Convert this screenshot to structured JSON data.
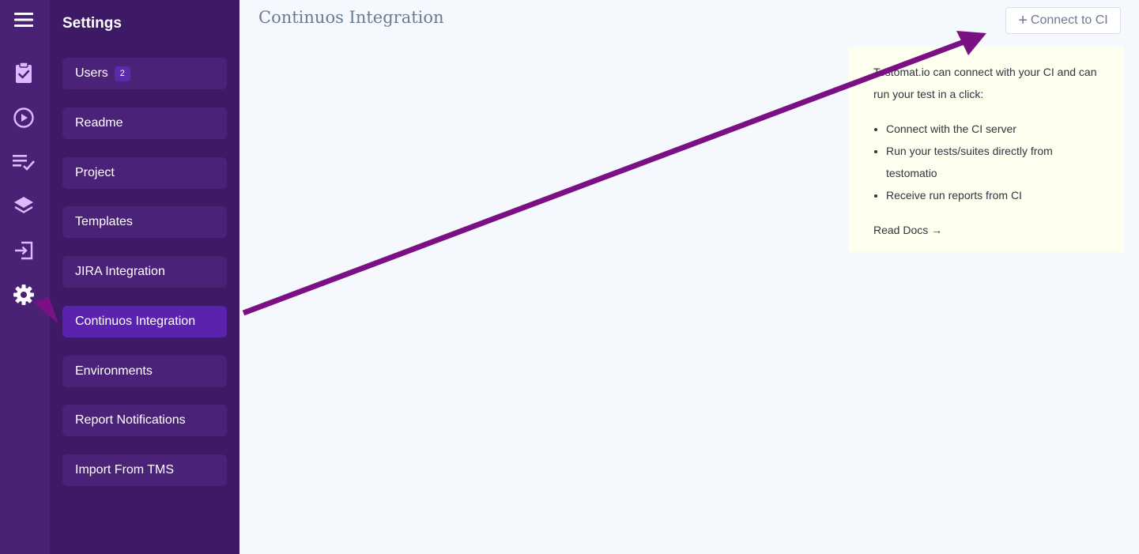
{
  "rail": {
    "icons": [
      "hamburger-menu-icon",
      "clipboard-check-icon",
      "play-circle-icon",
      "checklist-icon",
      "layers-icon",
      "import-icon",
      "gear-icon"
    ]
  },
  "sidebar": {
    "title": "Settings",
    "items": [
      {
        "label": "Users",
        "badge": "2"
      },
      {
        "label": "Readme"
      },
      {
        "label": "Project"
      },
      {
        "label": "Templates"
      },
      {
        "label": "JIRA Integration"
      },
      {
        "label": "Continuos Integration",
        "active": true
      },
      {
        "label": "Environments"
      },
      {
        "label": "Report Notifications"
      },
      {
        "label": "Import From TMS"
      }
    ]
  },
  "main": {
    "title": "Continuos Integration",
    "connect_button": {
      "icon": "+",
      "label": "Connect to CI"
    },
    "info": {
      "intro": "Testomat.io can connect with your CI and can run your test in a click:",
      "bullets": [
        "Connect with the CI server",
        "Run your tests/suites directly from testomatio",
        "Receive run reports from CI"
      ],
      "read_docs": "Read Docs →"
    }
  },
  "colors": {
    "rail_bg": "#4a2275",
    "sidebar_bg": "#3e1a66",
    "nav_item_bg": "#4a2378",
    "nav_active_bg": "#5a23ad",
    "annotation_arrow": "#7b1085",
    "info_bg": "#fffff0"
  }
}
